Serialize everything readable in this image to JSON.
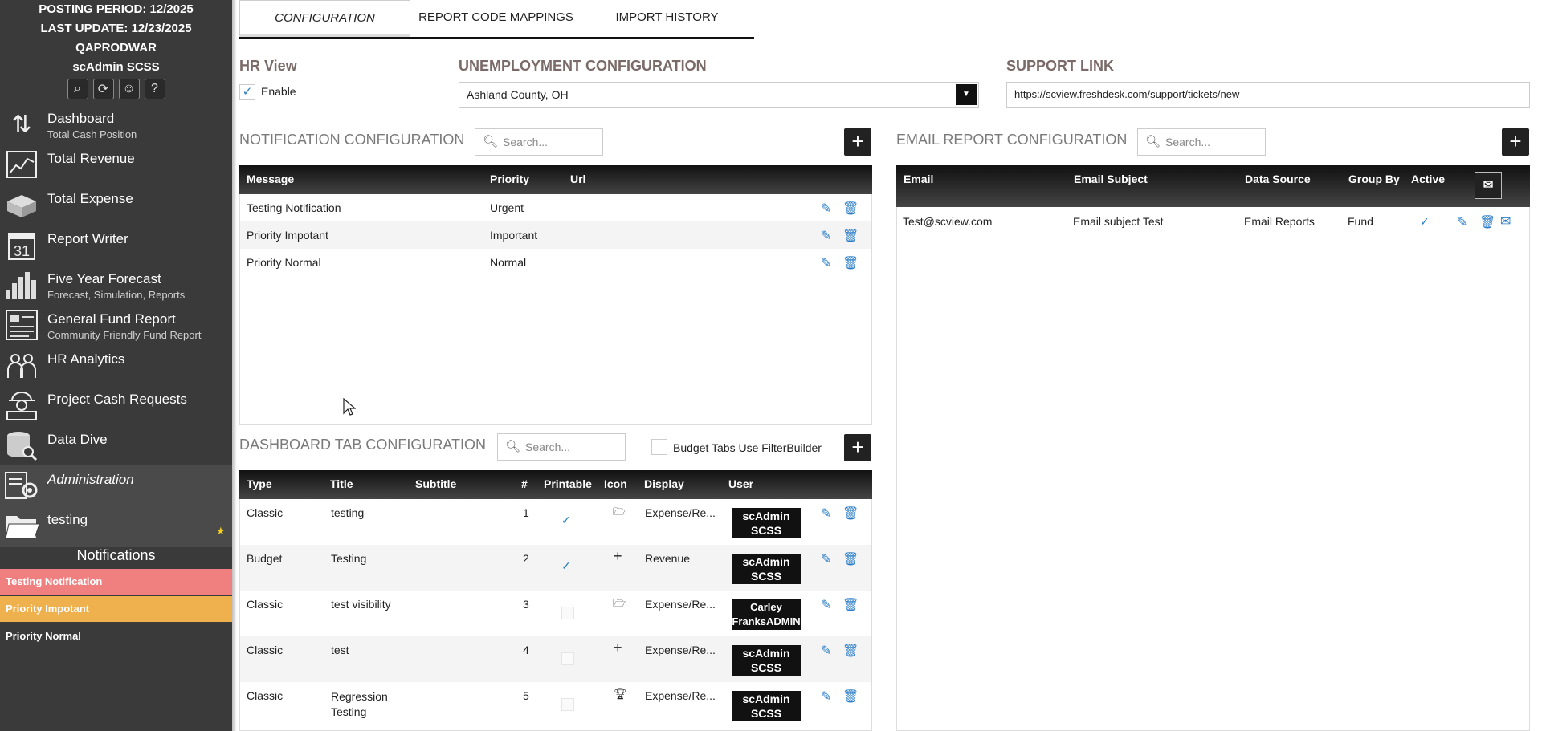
{
  "header": {
    "posting_period": "POSTING PERIOD: 12/2025",
    "last_update": "LAST UPDATE: 12/23/2025",
    "database": "QAPRODWAR",
    "user": "scAdmin SCSS"
  },
  "sidebar": {
    "items": [
      {
        "label": "Dashboard",
        "sub": "Total Cash Position",
        "icon": "arrows-icon"
      },
      {
        "label": "Total Revenue",
        "sub": "",
        "icon": "line-chart-icon"
      },
      {
        "label": "Total Expense",
        "sub": "",
        "icon": "open-box-icon"
      },
      {
        "label": "Report Writer",
        "sub": "",
        "icon": "calendar-icon"
      },
      {
        "label": "Five Year Forecast",
        "sub": "Forecast, Simulation, Reports",
        "icon": "bar-chart-icon"
      },
      {
        "label": "General Fund Report",
        "sub": "Community Friendly Fund Report",
        "icon": "report-icon"
      },
      {
        "label": "HR Analytics",
        "sub": "",
        "icon": "people-icon"
      },
      {
        "label": "Project Cash Requests",
        "sub": "",
        "icon": "worker-icon"
      },
      {
        "label": "Data Dive",
        "sub": "",
        "icon": "database-icon"
      },
      {
        "label": "Administration",
        "sub": "",
        "icon": "admin-gear-icon"
      },
      {
        "label": "testing",
        "sub": "",
        "icon": "folder-icon"
      }
    ],
    "notifications_title": "Notifications",
    "notifications": [
      {
        "label": "Testing Notification",
        "color": "#f08080"
      },
      {
        "label": "Priority Impotant",
        "color": "#efb14d"
      },
      {
        "label": "Priority Normal",
        "color": "#3a3a3a"
      }
    ]
  },
  "tabs": [
    "CONFIGURATION",
    "REPORT CODE MAPPINGS",
    "IMPORT HISTORY"
  ],
  "hr_view": {
    "title": "HR View",
    "enable_label": "Enable",
    "enabled": true
  },
  "unemployment": {
    "title": "UNEMPLOYMENT CONFIGURATION",
    "value": "Ashland County, OH"
  },
  "support": {
    "title": "SUPPORT LINK",
    "value": "https://scview.freshdesk.com/support/tickets/new"
  },
  "notification_config": {
    "title": "NOTIFICATION CONFIGURATION",
    "search_placeholder": "Search...",
    "columns": [
      "Message",
      "Priority",
      "Url"
    ],
    "rows": [
      {
        "message": "Testing Notification",
        "priority": "Urgent",
        "url": ""
      },
      {
        "message": "Priority Impotant",
        "priority": "Important",
        "url": ""
      },
      {
        "message": "Priority Normal",
        "priority": "Normal",
        "url": ""
      }
    ]
  },
  "email_config": {
    "title": "EMAIL REPORT CONFIGURATION",
    "search_placeholder": "Search...",
    "columns": [
      "Email",
      "Email Subject",
      "Data Source",
      "Group By",
      "Active"
    ],
    "rows": [
      {
        "email": "Test@scview.com",
        "subject": "Email subject Test",
        "source": "Email Reports",
        "group": "Fund",
        "active": true
      }
    ]
  },
  "dashboard_config": {
    "title": "DASHBOARD TAB CONFIGURATION",
    "search_placeholder": "Search...",
    "filterbuilder_label": "Budget Tabs Use FilterBuilder",
    "columns": [
      "Type",
      "Title",
      "Subtitle",
      "#",
      "Printable",
      "Icon",
      "Display",
      "User"
    ],
    "rows": [
      {
        "type": "Classic",
        "title": "testing",
        "title2": "",
        "subtitle": "",
        "num": "1",
        "printable": true,
        "icon": "folder-icon",
        "display": "Expense/Re...",
        "user1": "scAdmin",
        "user2": "SCSS"
      },
      {
        "type": "Budget",
        "title": "Testing",
        "title2": "",
        "subtitle": "",
        "num": "2",
        "printable": true,
        "icon": "plus-icon",
        "display": "Revenue",
        "user1": "scAdmin",
        "user2": "SCSS"
      },
      {
        "type": "Classic",
        "title": "test visibility",
        "title2": "",
        "subtitle": "",
        "num": "3",
        "printable": false,
        "icon": "folder-icon",
        "display": "Expense/Re...",
        "user1": "Carley",
        "user2": "FranksADMIN"
      },
      {
        "type": "Classic",
        "title": "test",
        "title2": "",
        "subtitle": "",
        "num": "4",
        "printable": false,
        "icon": "plus-icon",
        "display": "Expense/Re...",
        "user1": "scAdmin",
        "user2": "SCSS"
      },
      {
        "type": "Classic",
        "title": "Regression",
        "title2": "Testing",
        "subtitle": "",
        "num": "5",
        "printable": false,
        "icon": "trophy-icon",
        "display": "Expense/Re...",
        "user1": "scAdmin",
        "user2": "SCSS"
      }
    ]
  }
}
